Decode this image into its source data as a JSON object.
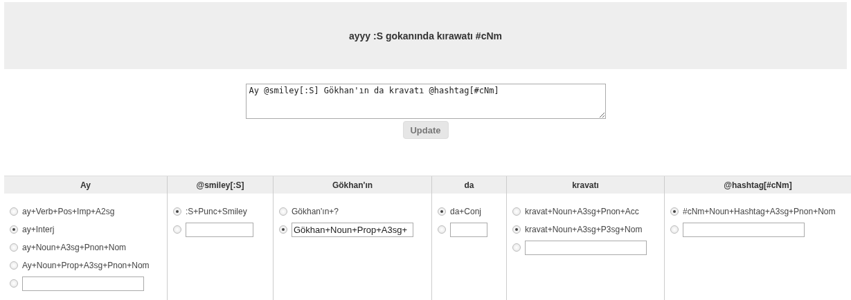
{
  "banner": {
    "title": "ayyy :S gokanında kırawatı #cNm"
  },
  "editor": {
    "value": "Ay @smiley[:S] Gökhan'ın da kravatı @hashtag[#cNm]",
    "button": "Update"
  },
  "columns": [
    {
      "word": "Ay",
      "options": [
        {
          "kind": "analysis",
          "text": "ay+Verb+Pos+Imp+A2sg",
          "selected": false
        },
        {
          "kind": "analysis",
          "text": "ay+Interj",
          "selected": true
        },
        {
          "kind": "analysis",
          "text": "ay+Noun+A3sg+Pnon+Nom",
          "selected": false
        },
        {
          "kind": "analysis",
          "text": "Ay+Noun+Prop+A3sg+Pnon+Nom",
          "selected": false
        },
        {
          "kind": "custom",
          "selected": false
        }
      ]
    },
    {
      "word": "@smiley[:S]",
      "options": [
        {
          "kind": "analysis",
          "text": ":S+Punc+Smiley",
          "selected": true
        },
        {
          "kind": "custom",
          "selected": false
        }
      ]
    },
    {
      "word": "Gökhan'ın",
      "options": [
        {
          "kind": "analysis",
          "text": "Gökhan'ın+?",
          "selected": false
        },
        {
          "kind": "custom",
          "value": "Gökhan+Noun+Prop+A3sg+",
          "selected": true
        }
      ]
    },
    {
      "word": "da",
      "options": [
        {
          "kind": "analysis",
          "text": "da+Conj",
          "selected": true
        },
        {
          "kind": "custom",
          "selected": false
        }
      ]
    },
    {
      "word": "kravatı",
      "options": [
        {
          "kind": "analysis",
          "text": "kravat+Noun+A3sg+Pnon+Acc",
          "selected": false
        },
        {
          "kind": "analysis",
          "text": "kravat+Noun+A3sg+P3sg+Nom",
          "selected": true
        },
        {
          "kind": "custom",
          "selected": false
        }
      ]
    },
    {
      "word": "@hashtag[#cNm]",
      "options": [
        {
          "kind": "analysis",
          "text": "#cNm+Noun+Hashtag+A3sg+Pnon+Nom",
          "selected": true
        },
        {
          "kind": "custom",
          "selected": false
        }
      ]
    }
  ]
}
